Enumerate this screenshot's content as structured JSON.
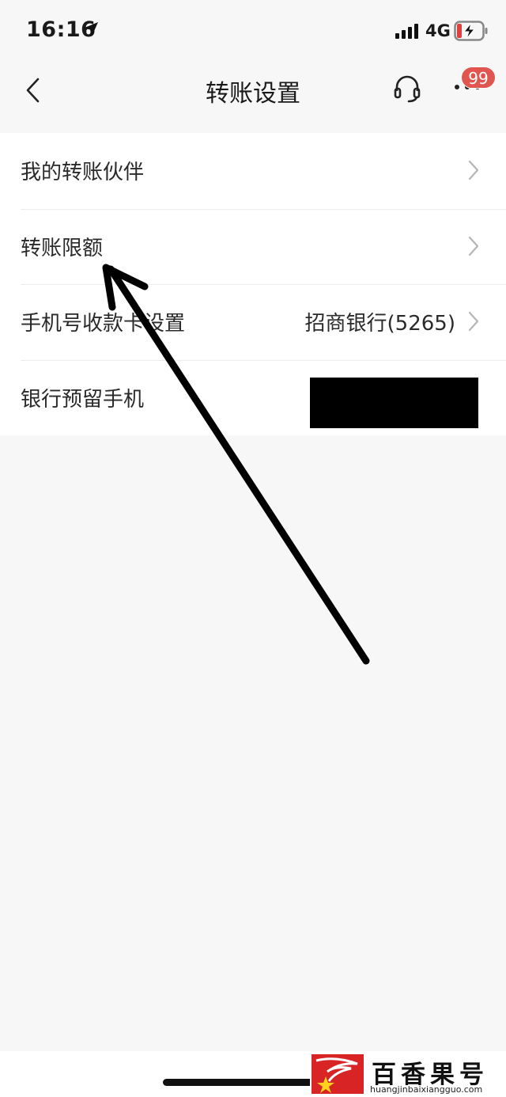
{
  "status_bar": {
    "time": "16:16",
    "network": "4G"
  },
  "nav": {
    "title": "转账设置",
    "badge_count": "99"
  },
  "list": {
    "items": [
      {
        "label": "我的转账伙伴",
        "value": ""
      },
      {
        "label": "转账限额",
        "value": ""
      },
      {
        "label": "手机号收款卡设置",
        "value": "招商银行(5265)"
      },
      {
        "label": "银行预留手机",
        "value": ""
      }
    ]
  },
  "watermark": {
    "title": "百香果号",
    "url": "huangjinbaixiangguo.com"
  },
  "colors": {
    "badge": "#e05550",
    "background": "#f7f7f7",
    "row_background": "#ffffff",
    "annotation_arrow": "#000000"
  },
  "icons": [
    "location-arrow-icon",
    "signal-icon",
    "battery-charging-icon",
    "back-arrow-icon",
    "headset-icon",
    "more-icon",
    "chevron-right-icon"
  ]
}
